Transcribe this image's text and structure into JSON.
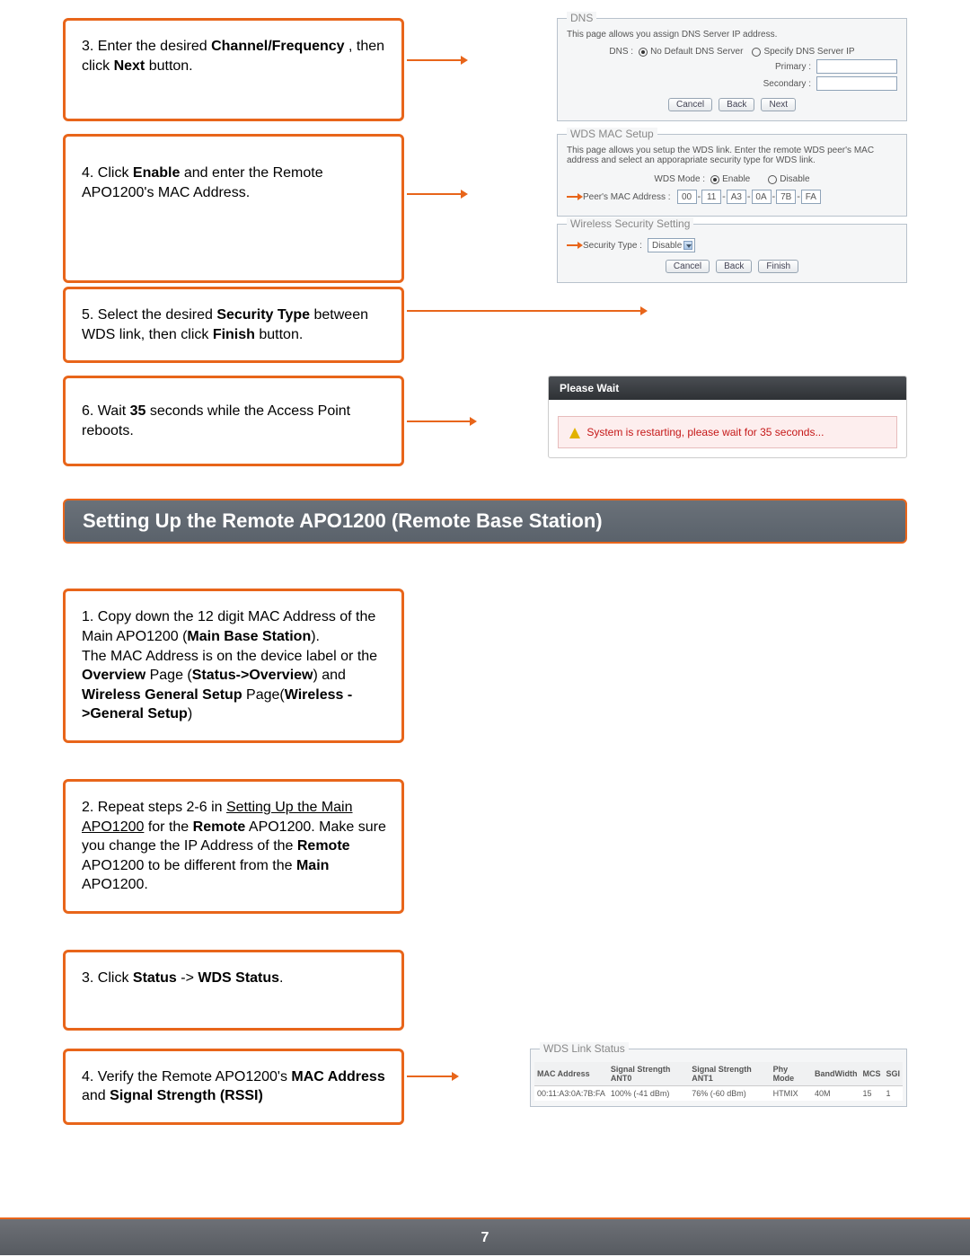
{
  "step3": {
    "text_a": "3. Enter the desired ",
    "bold_a": "Channel/Frequency",
    "text_b": " , then click ",
    "bold_b": "Next",
    "text_c": " button."
  },
  "dns": {
    "title": "DNS",
    "desc": "This page allows you assign DNS Server IP address.",
    "label": "DNS :",
    "opt1": "No Default DNS Server",
    "opt2": "Specify DNS Server IP",
    "primary": "Primary :",
    "secondary": "Secondary :",
    "cancel": "Cancel",
    "back": "Back",
    "next": "Next"
  },
  "step4": {
    "text_a": "4. Click ",
    "bold_a": "Enable",
    "text_b": " and enter the Remote APO1200's MAC Address."
  },
  "wds": {
    "title": "WDS MAC Setup",
    "desc": "This page allows you setup the WDS link. Enter the remote WDS peer's MAC address and select an apporapriate security type for WDS link.",
    "mode_label": "WDS Mode :",
    "enable": "Enable",
    "disable": "Disable",
    "mac_label": "Peer's MAC Address :",
    "mac": [
      "00",
      "11",
      "A3",
      "0A",
      "7B",
      "FA"
    ]
  },
  "step5": {
    "text_a": "5. Select the desired ",
    "bold_a": "Security Type",
    "text_b": " between WDS link, then click ",
    "bold_b": "Finish",
    "text_c": " button."
  },
  "sec": {
    "title": "Wireless Security Setting",
    "label": "Security Type :",
    "value": "Disable",
    "cancel": "Cancel",
    "back": "Back",
    "finish": "Finish"
  },
  "step6": {
    "text_a": "6. Wait ",
    "bold_a": "35",
    "text_b": " seconds while the Access Point reboots."
  },
  "wait": {
    "head": "Please Wait",
    "body": "System is restarting, please wait for 35 seconds..."
  },
  "section": "Setting Up the Remote APO1200 (Remote Base Station)",
  "bstep1": {
    "l1": "1. Copy down the 12 digit MAC Address of the Main APO1200 (",
    "b1": "Main Base Station",
    "l2": ").",
    "l3": "The MAC Address is on the device label or  the ",
    "b2": "Overview",
    "l4": " Page (",
    "b3": "Status->Overview",
    "l5": ") and ",
    "b4": "Wireless General Setup",
    "l6": " Page(",
    "b5": "Wireless ->General Setup",
    "l7": ")"
  },
  "bstep2": {
    "l1": "2. Repeat steps 2-6 in ",
    "u1": "Setting Up the Main APO1200",
    "l2": " for the ",
    "b1": "Remote",
    "l3": " APO1200. Make sure you change the IP Address of the ",
    "b2": "Remote",
    "l4": " APO1200 to be different from the ",
    "b3": "Main",
    "l5": " APO1200."
  },
  "bstep3": {
    "l1": "3. Click ",
    "b1": "Status",
    "l2": " -> ",
    "b2": "WDS Status",
    "l3": "."
  },
  "bstep4": {
    "l1": "4. Verify the Remote APO1200's ",
    "b1": "MAC Address",
    "l2": " and ",
    "b2": "Signal Strength (RSSI)"
  },
  "wdsstatus": {
    "title": "WDS Link Status",
    "headers": [
      "MAC Address",
      "Signal Strength ANT0",
      "Signal Strength ANT1",
      "Phy Mode",
      "BandWidth",
      "MCS",
      "SGI"
    ],
    "row": [
      "00:11:A3:0A:7B:FA",
      "100% (-41 dBm)",
      "76% (-60 dBm)",
      "HTMIX",
      "40M",
      "15",
      "1"
    ]
  },
  "page_number": "7"
}
